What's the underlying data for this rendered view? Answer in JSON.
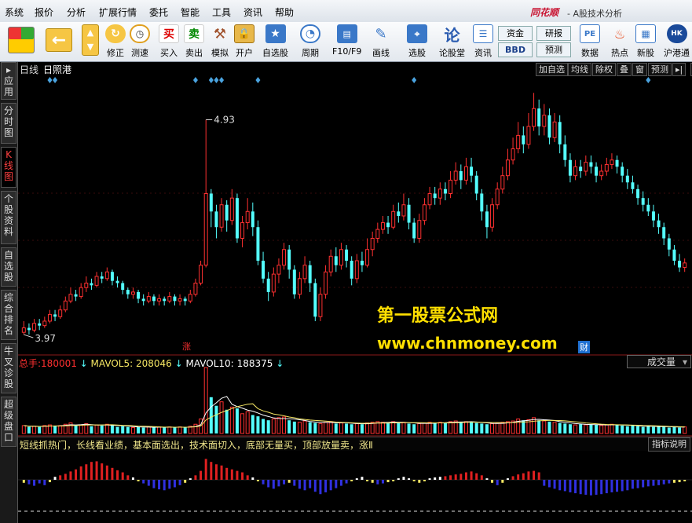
{
  "menu": [
    "系统",
    "报价",
    "分析",
    "扩展行情",
    "委托",
    "智能",
    "工具",
    "资讯",
    "帮助"
  ],
  "app": {
    "logo": "同花顺",
    "title": "- A股技术分析"
  },
  "toolbar": [
    {
      "name": "layout-button",
      "label": "",
      "icon": "grid-icon"
    },
    {
      "name": "back-button",
      "label": "",
      "icon": "arrow-left-icon"
    },
    {
      "name": "pageup-button",
      "label": "",
      "icon": "arrow-updown-icon"
    },
    {
      "name": "revise-button",
      "label": "修正",
      "icon": "revise-icon"
    },
    {
      "name": "speed-button",
      "label": "测速",
      "icon": "clock-icon"
    },
    {
      "name": "buy-button",
      "label": "买入",
      "icon": "buy-icon",
      "glyph": "买"
    },
    {
      "name": "sell-button",
      "label": "卖出",
      "icon": "sell-icon",
      "glyph": "卖"
    },
    {
      "name": "simulate-button",
      "label": "模拟",
      "icon": "hammer-icon"
    },
    {
      "name": "open-account-button",
      "label": "开户",
      "icon": "lock-icon"
    },
    {
      "name": "self-select-button",
      "label": "自选股",
      "icon": "star-icon"
    },
    {
      "name": "period-button",
      "label": "周期",
      "icon": "period-icon"
    },
    {
      "name": "f10-button",
      "label": "F10/F9",
      "icon": "f10-icon"
    },
    {
      "name": "draw-line-button",
      "label": "画线",
      "icon": "pencil-icon"
    },
    {
      "name": "pick-stock-button",
      "label": "选股",
      "icon": "pick-icon"
    },
    {
      "name": "forum-button",
      "label": "论股堂",
      "icon": "forum-icon",
      "glyph": "论"
    },
    {
      "name": "news-button",
      "label": "资讯",
      "icon": "news-icon"
    },
    {
      "name": "funds-button",
      "label": "资金",
      "icon": "funds-icon"
    },
    {
      "name": "bbd-button",
      "label": "BBD",
      "icon": "bbd-icon"
    },
    {
      "name": "research-button",
      "label": "研报",
      "icon": "research-icon"
    },
    {
      "name": "forecast-button",
      "label": "预测",
      "icon": "forecast-icon"
    },
    {
      "name": "data-button",
      "label": "数据",
      "icon": "pe-icon",
      "glyph": "PE"
    },
    {
      "name": "hotspot-button",
      "label": "热点",
      "icon": "fire-icon"
    },
    {
      "name": "new-stock-button",
      "label": "新股",
      "icon": "newstock-icon"
    },
    {
      "name": "hk-connect-button",
      "label": "沪港通",
      "icon": "hk-icon"
    }
  ],
  "sidebar": [
    "应用",
    "分时图",
    "K线图",
    "个股资料",
    "自选股",
    "综合排名",
    "牛叉诊股",
    "超级盘口"
  ],
  "chart_head": {
    "period": "日线",
    "stock_name": "日照港",
    "buttons": [
      "加自选",
      "均线",
      "除权",
      "叠",
      "窗",
      "预测"
    ]
  },
  "price_labels": {
    "high": "4.93",
    "low": "3.97",
    "limit_up_mark": "涨"
  },
  "volume_info": {
    "total_label": "总手:",
    "total_value": "180001",
    "mavol5_label": "MAVOL5:",
    "mavol5_value": "208046",
    "mavol10_label": "MAVOL10:",
    "mavol10_value": "188375",
    "combo": "成交量"
  },
  "indicator": {
    "text": "短线抓热门，长线看业绩，基本面选出，技术面切入，底部无量买，顶部放量卖，涨Ⅱ",
    "help": "指标说明"
  },
  "watermark": {
    "line1": "第一股票公式网",
    "line2": "www.chnmoney.com",
    "badge": "财"
  },
  "colors": {
    "up": "#ff3030",
    "down": "#54ffff",
    "ma_white": "#ffffff",
    "ma_yellow": "#f5e663",
    "accent": "#c8102e"
  },
  "chart_data": {
    "type": "candlestick",
    "title": "日照港",
    "period": "日线",
    "ylim": [
      3.9,
      5.1
    ],
    "annotated_high": 4.93,
    "annotated_low": 3.97,
    "candles": [
      [
        3.98,
        4.0,
        3.97,
        4.03
      ],
      [
        4.0,
        3.99,
        3.97,
        4.02
      ],
      [
        3.99,
        4.02,
        3.98,
        4.04
      ],
      [
        4.02,
        4.01,
        3.99,
        4.04
      ],
      [
        4.01,
        4.03,
        4.0,
        4.05
      ],
      [
        4.03,
        4.06,
        4.02,
        4.08
      ],
      [
        4.06,
        4.05,
        4.03,
        4.08
      ],
      [
        4.05,
        4.08,
        4.04,
        4.1
      ],
      [
        4.08,
        4.12,
        4.07,
        4.14
      ],
      [
        4.12,
        4.15,
        4.11,
        4.18
      ],
      [
        4.15,
        4.14,
        4.12,
        4.17
      ],
      [
        4.14,
        4.18,
        4.13,
        4.2
      ],
      [
        4.18,
        4.2,
        4.16,
        4.23
      ],
      [
        4.2,
        4.19,
        4.17,
        4.22
      ],
      [
        4.19,
        4.23,
        4.18,
        4.25
      ],
      [
        4.23,
        4.22,
        4.2,
        4.25
      ],
      [
        4.22,
        4.25,
        4.21,
        4.27
      ],
      [
        4.25,
        4.21,
        4.19,
        4.26
      ],
      [
        4.21,
        4.2,
        4.18,
        4.23
      ],
      [
        4.2,
        4.17,
        4.15,
        4.21
      ],
      [
        4.17,
        4.15,
        4.13,
        4.18
      ],
      [
        4.15,
        4.16,
        4.13,
        4.18
      ],
      [
        4.16,
        4.13,
        4.11,
        4.17
      ],
      [
        4.13,
        4.12,
        4.1,
        4.15
      ],
      [
        4.12,
        4.14,
        4.11,
        4.16
      ],
      [
        4.14,
        4.12,
        4.1,
        4.15
      ],
      [
        4.12,
        4.13,
        4.1,
        4.15
      ],
      [
        4.13,
        4.12,
        4.1,
        4.14
      ],
      [
        4.12,
        4.14,
        4.11,
        4.16
      ],
      [
        4.14,
        4.12,
        4.1,
        4.15
      ],
      [
        4.12,
        4.13,
        4.1,
        4.15
      ],
      [
        4.13,
        4.12,
        4.1,
        4.14
      ],
      [
        4.12,
        4.15,
        4.11,
        4.17
      ],
      [
        4.15,
        4.2,
        4.14,
        4.22
      ],
      [
        4.2,
        4.28,
        4.19,
        4.3
      ],
      [
        4.28,
        4.6,
        4.27,
        4.93
      ],
      [
        4.6,
        4.52,
        4.45,
        4.62
      ],
      [
        4.52,
        4.45,
        4.4,
        4.55
      ],
      [
        4.45,
        4.55,
        4.43,
        4.58
      ],
      [
        4.55,
        4.48,
        4.43,
        4.57
      ],
      [
        4.48,
        4.58,
        4.46,
        4.62
      ],
      [
        4.58,
        4.4,
        4.38,
        4.6
      ],
      [
        4.4,
        4.47,
        4.36,
        4.5
      ],
      [
        4.47,
        4.52,
        4.44,
        4.58
      ],
      [
        4.52,
        4.45,
        4.41,
        4.56
      ],
      [
        4.45,
        4.3,
        4.28,
        4.48
      ],
      [
        4.3,
        4.22,
        4.2,
        4.34
      ],
      [
        4.22,
        4.16,
        4.12,
        4.25
      ],
      [
        4.16,
        4.24,
        4.14,
        4.27
      ],
      [
        4.24,
        4.28,
        4.2,
        4.31
      ],
      [
        4.28,
        4.35,
        4.26,
        4.38
      ],
      [
        4.35,
        4.26,
        4.22,
        4.37
      ],
      [
        4.26,
        4.15,
        4.13,
        4.28
      ],
      [
        4.15,
        4.22,
        4.13,
        4.25
      ],
      [
        4.22,
        4.28,
        4.2,
        4.32
      ],
      [
        4.28,
        4.2,
        4.16,
        4.3
      ],
      [
        4.2,
        4.05,
        4.03,
        4.22
      ],
      [
        4.05,
        4.15,
        4.03,
        4.18
      ],
      [
        4.15,
        4.25,
        4.13,
        4.28
      ],
      [
        4.25,
        4.32,
        4.23,
        4.35
      ],
      [
        4.32,
        4.28,
        4.25,
        4.36
      ],
      [
        4.28,
        4.35,
        4.26,
        4.38
      ],
      [
        4.35,
        4.3,
        4.27,
        4.37
      ],
      [
        4.3,
        4.22,
        4.19,
        4.32
      ],
      [
        4.22,
        4.3,
        4.2,
        4.33
      ],
      [
        4.3,
        4.28,
        4.25,
        4.34
      ],
      [
        4.28,
        4.35,
        4.27,
        4.4
      ],
      [
        4.35,
        4.4,
        4.32,
        4.43
      ],
      [
        4.4,
        4.44,
        4.38,
        4.47
      ],
      [
        4.44,
        4.47,
        4.42,
        4.5
      ],
      [
        4.47,
        4.45,
        4.42,
        4.5
      ],
      [
        4.45,
        4.52,
        4.44,
        4.55
      ],
      [
        4.52,
        4.5,
        4.47,
        4.56
      ],
      [
        4.5,
        4.55,
        4.48,
        4.6
      ],
      [
        4.55,
        4.47,
        4.44,
        4.58
      ],
      [
        4.47,
        4.4,
        4.38,
        4.49
      ],
      [
        4.4,
        4.48,
        4.38,
        4.51
      ],
      [
        4.48,
        4.55,
        4.46,
        4.58
      ],
      [
        4.55,
        4.6,
        4.53,
        4.63
      ],
      [
        4.6,
        4.58,
        4.55,
        4.63
      ],
      [
        4.58,
        4.62,
        4.55,
        4.65
      ],
      [
        4.62,
        4.6,
        4.57,
        4.65
      ],
      [
        4.6,
        4.66,
        4.58,
        4.7
      ],
      [
        4.66,
        4.7,
        4.64,
        4.74
      ],
      [
        4.7,
        4.66,
        4.62,
        4.73
      ],
      [
        4.66,
        4.72,
        4.64,
        4.76
      ],
      [
        4.72,
        4.68,
        4.65,
        4.76
      ],
      [
        4.68,
        4.6,
        4.57,
        4.7
      ],
      [
        4.6,
        4.52,
        4.48,
        4.62
      ],
      [
        4.52,
        4.45,
        4.4,
        4.55
      ],
      [
        4.45,
        4.55,
        4.43,
        4.58
      ],
      [
        4.55,
        4.62,
        4.53,
        4.65
      ],
      [
        4.62,
        4.68,
        4.6,
        4.72
      ],
      [
        4.68,
        4.75,
        4.66,
        4.8
      ],
      [
        4.75,
        4.8,
        4.73,
        4.85
      ],
      [
        4.8,
        4.86,
        4.78,
        4.92
      ],
      [
        4.86,
        4.82,
        4.78,
        4.9
      ],
      [
        4.82,
        4.9,
        4.8,
        4.96
      ],
      [
        4.9,
        4.98,
        4.88,
        5.05
      ],
      [
        4.98,
        4.9,
        4.86,
        5.02
      ],
      [
        4.9,
        4.95,
        4.86,
        5.0
      ],
      [
        4.95,
        4.85,
        4.82,
        4.98
      ],
      [
        4.85,
        4.92,
        4.83,
        4.96
      ],
      [
        4.92,
        4.82,
        4.78,
        4.95
      ],
      [
        4.82,
        4.75,
        4.72,
        4.86
      ],
      [
        4.75,
        4.68,
        4.65,
        4.78
      ],
      [
        4.68,
        4.72,
        4.66,
        4.75
      ],
      [
        4.72,
        4.7,
        4.67,
        4.75
      ],
      [
        4.7,
        4.74,
        4.68,
        4.77
      ],
      [
        4.74,
        4.72,
        4.69,
        4.77
      ],
      [
        4.72,
        4.68,
        4.65,
        4.74
      ],
      [
        4.68,
        4.7,
        4.66,
        4.73
      ],
      [
        4.7,
        4.73,
        4.68,
        4.76
      ],
      [
        4.73,
        4.75,
        4.71,
        4.78
      ],
      [
        4.75,
        4.72,
        4.69,
        4.77
      ],
      [
        4.72,
        4.68,
        4.65,
        4.74
      ],
      [
        4.68,
        4.65,
        4.62,
        4.71
      ],
      [
        4.65,
        4.62,
        4.6,
        4.68
      ],
      [
        4.62,
        4.58,
        4.55,
        4.64
      ],
      [
        4.58,
        4.55,
        4.52,
        4.61
      ],
      [
        4.55,
        4.52,
        4.5,
        4.58
      ],
      [
        4.52,
        4.48,
        4.45,
        4.55
      ],
      [
        4.48,
        4.45,
        4.42,
        4.51
      ],
      [
        4.45,
        4.4,
        4.37,
        4.47
      ],
      [
        4.4,
        4.35,
        4.32,
        4.42
      ],
      [
        4.35,
        4.3,
        4.28,
        4.37
      ],
      [
        4.3,
        4.27,
        4.25,
        4.33
      ],
      [
        4.27,
        4.29,
        4.25,
        4.31
      ]
    ],
    "volume_ratio": [
      0.12,
      0.1,
      0.11,
      0.1,
      0.12,
      0.13,
      0.11,
      0.12,
      0.14,
      0.16,
      0.12,
      0.13,
      0.15,
      0.11,
      0.13,
      0.12,
      0.14,
      0.12,
      0.1,
      0.11,
      0.1,
      0.09,
      0.1,
      0.09,
      0.1,
      0.09,
      0.1,
      0.09,
      0.1,
      0.09,
      0.1,
      0.09,
      0.11,
      0.14,
      0.22,
      1.0,
      0.55,
      0.42,
      0.48,
      0.36,
      0.4,
      0.38,
      0.3,
      0.33,
      0.28,
      0.26,
      0.22,
      0.2,
      0.22,
      0.24,
      0.25,
      0.2,
      0.18,
      0.17,
      0.19,
      0.17,
      0.16,
      0.15,
      0.17,
      0.18,
      0.15,
      0.16,
      0.15,
      0.14,
      0.15,
      0.14,
      0.16,
      0.17,
      0.18,
      0.17,
      0.16,
      0.18,
      0.16,
      0.17,
      0.15,
      0.14,
      0.15,
      0.16,
      0.17,
      0.16,
      0.17,
      0.16,
      0.18,
      0.19,
      0.17,
      0.18,
      0.17,
      0.16,
      0.15,
      0.14,
      0.15,
      0.16,
      0.17,
      0.18,
      0.19,
      0.22,
      0.2,
      0.21,
      0.24,
      0.2,
      0.19,
      0.18,
      0.17,
      0.16,
      0.15,
      0.14,
      0.13,
      0.14,
      0.13,
      0.14,
      0.13,
      0.12,
      0.13,
      0.14,
      0.13,
      0.12,
      0.11,
      0.12,
      0.11,
      0.1,
      0.11,
      0.1,
      0.11,
      0.1,
      0.09,
      0.1,
      0.09,
      0.1
    ],
    "diamond_markers": [
      5,
      6,
      33,
      36,
      37,
      38,
      45,
      75,
      120
    ],
    "indicator_bars": [
      -0.1,
      -0.15,
      -0.2,
      -0.12,
      -0.18,
      -0.08,
      0.1,
      0.15,
      0.2,
      0.28,
      0.35,
      0.45,
      0.52,
      0.6,
      0.62,
      0.55,
      0.48,
      0.4,
      0.32,
      0.25,
      0.15,
      0.08,
      -0.05,
      -0.12,
      -0.2,
      -0.28,
      -0.32,
      -0.35,
      -0.3,
      -0.25,
      -0.18,
      -0.1,
      0.05,
      0.15,
      0.3,
      0.7,
      0.6,
      0.52,
      0.48,
      0.4,
      0.35,
      0.3,
      0.25,
      0.15,
      0.08,
      -0.05,
      -0.15,
      -0.25,
      -0.3,
      -0.22,
      -0.15,
      -0.1,
      -0.2,
      -0.3,
      -0.35,
      -0.28,
      -0.4,
      -0.48,
      -0.42,
      -0.35,
      -0.28,
      -0.2,
      -0.12,
      -0.05,
      0.05,
      0.1,
      -0.05,
      -0.1,
      -0.15,
      -0.12,
      -0.08,
      -0.05,
      0.05,
      0.1,
      0.05,
      -0.05,
      -0.1,
      -0.05,
      0.05,
      0.08,
      0.1,
      0.12,
      0.15,
      0.18,
      0.2,
      0.25,
      0.28,
      0.22,
      0.15,
      0.05,
      -0.1,
      -0.18,
      -0.1,
      0.05,
      0.12,
      0.18,
      0.22,
      0.28,
      0.3,
      0.25,
      -0.2,
      -0.25,
      -0.3,
      -0.35,
      -0.38,
      -0.42,
      -0.45,
      -0.48,
      -0.5,
      -0.52,
      -0.5,
      -0.48,
      -0.45,
      -0.42,
      -0.4,
      -0.38,
      -0.35,
      -0.3,
      -0.28,
      -0.25,
      -0.22,
      -0.2,
      -0.18,
      -0.15,
      -0.12,
      -0.1,
      -0.08,
      -0.05
    ]
  }
}
